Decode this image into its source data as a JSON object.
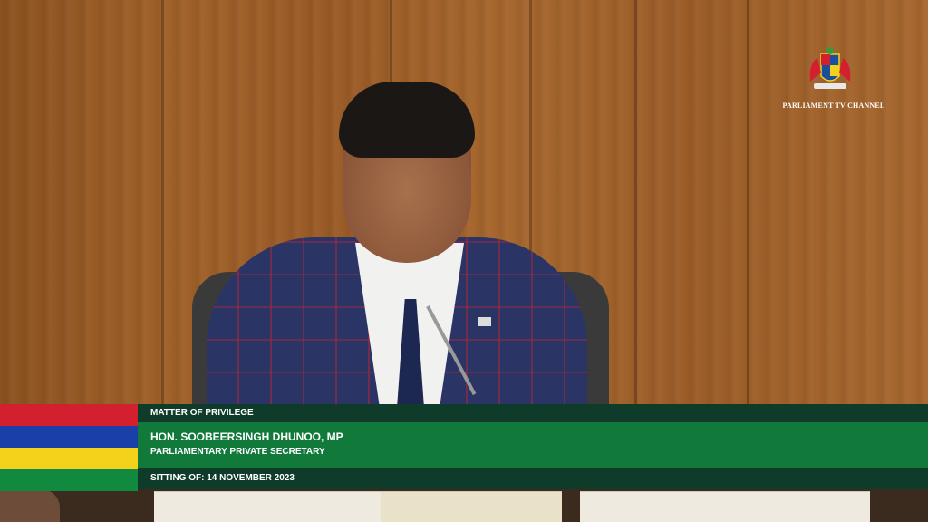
{
  "logo": {
    "channel_name": "PARLIAMENT TV CHANNEL"
  },
  "lower_third": {
    "topic": "MATTER OF PRIVILEGE",
    "speaker_name": "HON. SOOBEERSINGH DHUNOO, MP",
    "speaker_role": "PARLIAMENTARY PRIVATE SECRETARY",
    "sitting": "SITTING OF: 14 NOVEMBER 2023"
  },
  "flag_colors": [
    "#d2202e",
    "#1a3fa6",
    "#f2d21b",
    "#118a3f"
  ],
  "colors": {
    "band_dark": "#0f3b2a",
    "band_green": "#117a3b"
  }
}
